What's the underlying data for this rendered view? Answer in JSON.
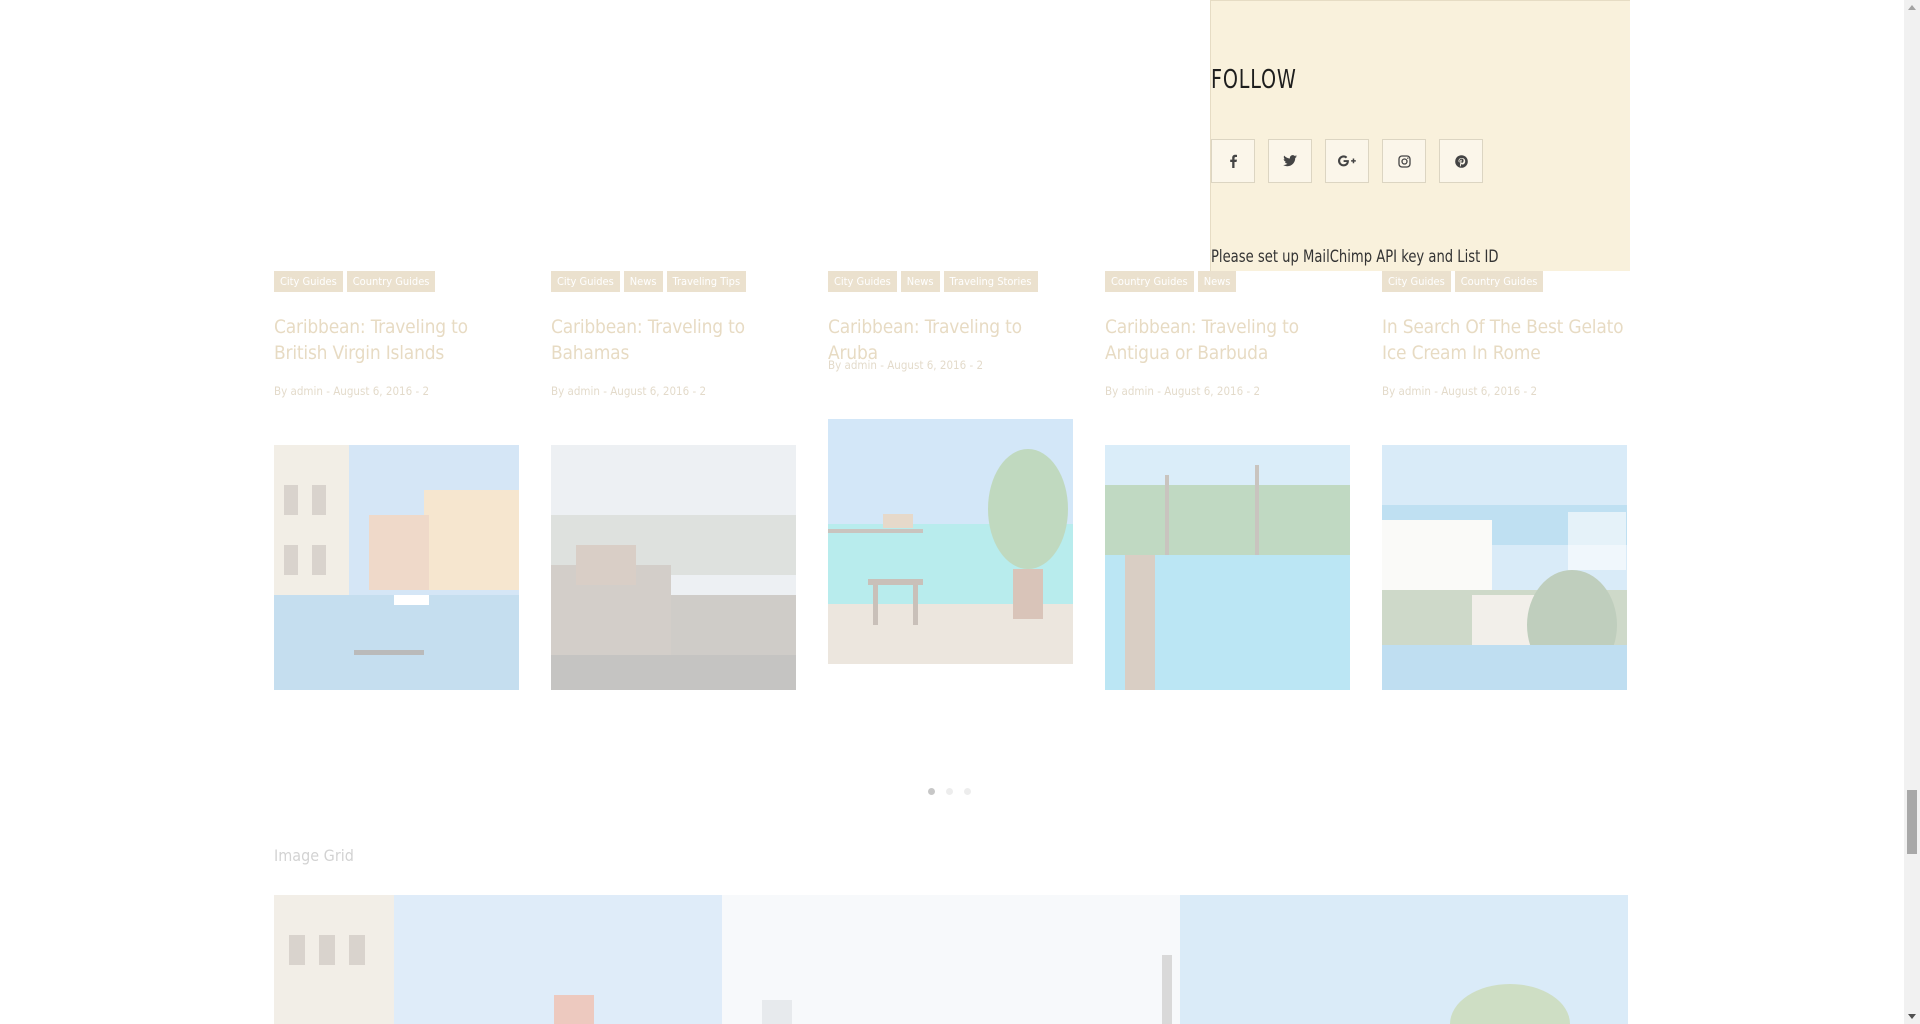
{
  "posts": [
    {
      "categories": [
        "City Guides",
        "Country Guides"
      ],
      "title": "Caribbean: Traveling to British Virgin Islands",
      "meta": "By admin - August 6, 2016 - 2",
      "image": "venice-canal"
    },
    {
      "categories": [
        "City Guides",
        "News",
        "Traveling Tips"
      ],
      "title": "Caribbean: Traveling to Bahamas",
      "meta": "By admin - August 6, 2016 - 2",
      "image": "barcelona-park"
    },
    {
      "categories": [
        "City Guides",
        "News",
        "Traveling Stories"
      ],
      "title": "Caribbean: Traveling to Aruba",
      "meta": "By admin - August 6, 2016 - 2",
      "image": "beach-pier-table"
    },
    {
      "categories": [
        "Country Guides",
        "News"
      ],
      "title": "Caribbean: Traveling to Antigua or Barbuda",
      "meta": "By admin - August 6, 2016 - 2",
      "image": "pool-palms"
    },
    {
      "categories": [
        "City Guides",
        "Country Guides"
      ],
      "title": "In Search Of The Best Gelato Ice Cream In Rome",
      "meta": "By admin - August 6, 2016 - 2",
      "image": "resort-hotel"
    }
  ],
  "slider": {
    "dots": 3,
    "active_dot": 0
  },
  "image_grid": {
    "label": "Image Grid"
  },
  "follow_widget": {
    "title": "FOLLOW",
    "socials": [
      {
        "name": "facebook",
        "icon": "facebook-icon"
      },
      {
        "name": "twitter",
        "icon": "twitter-icon"
      },
      {
        "name": "google-plus",
        "icon": "google-plus-icon"
      },
      {
        "name": "instagram",
        "icon": "instagram-icon"
      },
      {
        "name": "pinterest",
        "icon": "pinterest-icon"
      }
    ],
    "note": "Please set up MailChimp API key and List ID"
  },
  "colors": {
    "widget_background": "#f9f1dc",
    "accent": "#c2a56a"
  }
}
